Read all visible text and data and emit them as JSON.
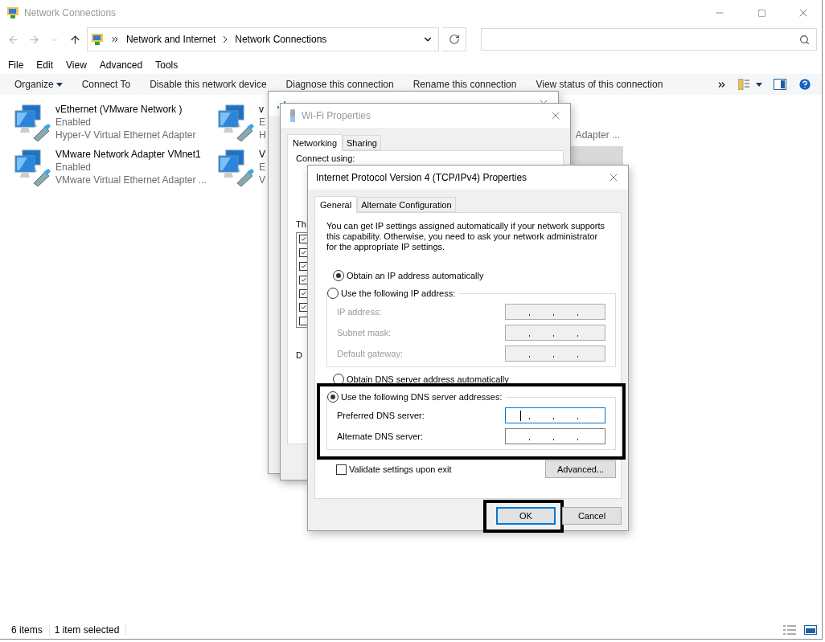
{
  "window": {
    "title": "Network Connections"
  },
  "address_bar": {
    "crumbs": [
      "Network and Internet",
      "Network Connections"
    ]
  },
  "menu": [
    "File",
    "Edit",
    "View",
    "Advanced",
    "Tools"
  ],
  "commands": [
    {
      "label": "Organize",
      "dropdown": true
    },
    {
      "label": "Connect To",
      "dropdown": false
    },
    {
      "label": "Disable this network device",
      "dropdown": false
    },
    {
      "label": "Diagnose this connection",
      "dropdown": false
    },
    {
      "label": "Rename this connection",
      "dropdown": false
    },
    {
      "label": "View status of this connection",
      "dropdown": false
    }
  ],
  "adapters": [
    {
      "kind": "full",
      "name": "vEthernet (VMware Network )",
      "status": "Enabled",
      "device": "Hyper-V Virtual Ethernet Adapter",
      "selected": false
    },
    {
      "kind": "full",
      "name": "v",
      "status": "E",
      "device": "H",
      "selected": false
    },
    {
      "kind": "fragment",
      "device": "Adapter ...",
      "selected": false
    },
    {
      "kind": "full",
      "name": "VMware Network Adapter VMnet1",
      "status": "Enabled",
      "device": "VMware Virtual Ethernet Adapter ...",
      "selected": false
    },
    {
      "kind": "full",
      "name": "V",
      "status": "E",
      "device": "V",
      "selected": false
    },
    {
      "kind": "fragment",
      "selected": true
    }
  ],
  "status_bar": {
    "count": "6 items",
    "selection": "1 item selected"
  },
  "wifi_properties": {
    "title": "Wi-Fi Properties",
    "tabs": [
      {
        "label": "Networking",
        "selected": true
      },
      {
        "label": "Sharing",
        "selected": false
      }
    ],
    "connect_label": "Connect using:",
    "items_label": "Th",
    "group_label": "D",
    "items": [
      {
        "checked": true
      },
      {
        "checked": true
      },
      {
        "checked": true
      },
      {
        "checked": true
      },
      {
        "checked": true
      },
      {
        "checked": true
      },
      {
        "checked": false
      }
    ]
  },
  "ipv4": {
    "title": "Internet Protocol Version 4 (TCP/IPv4) Properties",
    "tabs": [
      {
        "label": "General",
        "selected": true
      },
      {
        "label": "Alternate Configuration",
        "selected": false
      }
    ],
    "intro": "You can get IP settings assigned automatically if your network supports this capability. Otherwise, you need to ask your network administrator for the appropriate IP settings.",
    "ip_options": [
      {
        "label": "Obtain an IP address automatically",
        "selected": true
      },
      {
        "label": "Use the following IP address:",
        "selected": false
      }
    ],
    "ip_fields": [
      {
        "label": "IP address:",
        "disabled": true,
        "focused": false
      },
      {
        "label": "Subnet mask:",
        "disabled": true,
        "focused": false
      },
      {
        "label": "Default gateway:",
        "disabled": true,
        "focused": false
      }
    ],
    "dns_options": [
      {
        "label": "Obtain DNS server address automatically",
        "selected": false
      },
      {
        "label": "Use the following DNS server addresses:",
        "selected": true
      }
    ],
    "dns_fields": [
      {
        "label": "Preferred DNS server:",
        "disabled": false,
        "focused": true
      },
      {
        "label": "Alternate DNS server:",
        "disabled": false,
        "focused": false
      }
    ],
    "dns_highlighted": true,
    "validate": {
      "label": "Validate settings upon exit",
      "checked": false
    },
    "advanced": "Advanced...",
    "buttons": [
      {
        "label": "OK",
        "default": true,
        "highlighted": true
      },
      {
        "label": "Cancel",
        "default": false,
        "highlighted": false
      }
    ]
  }
}
